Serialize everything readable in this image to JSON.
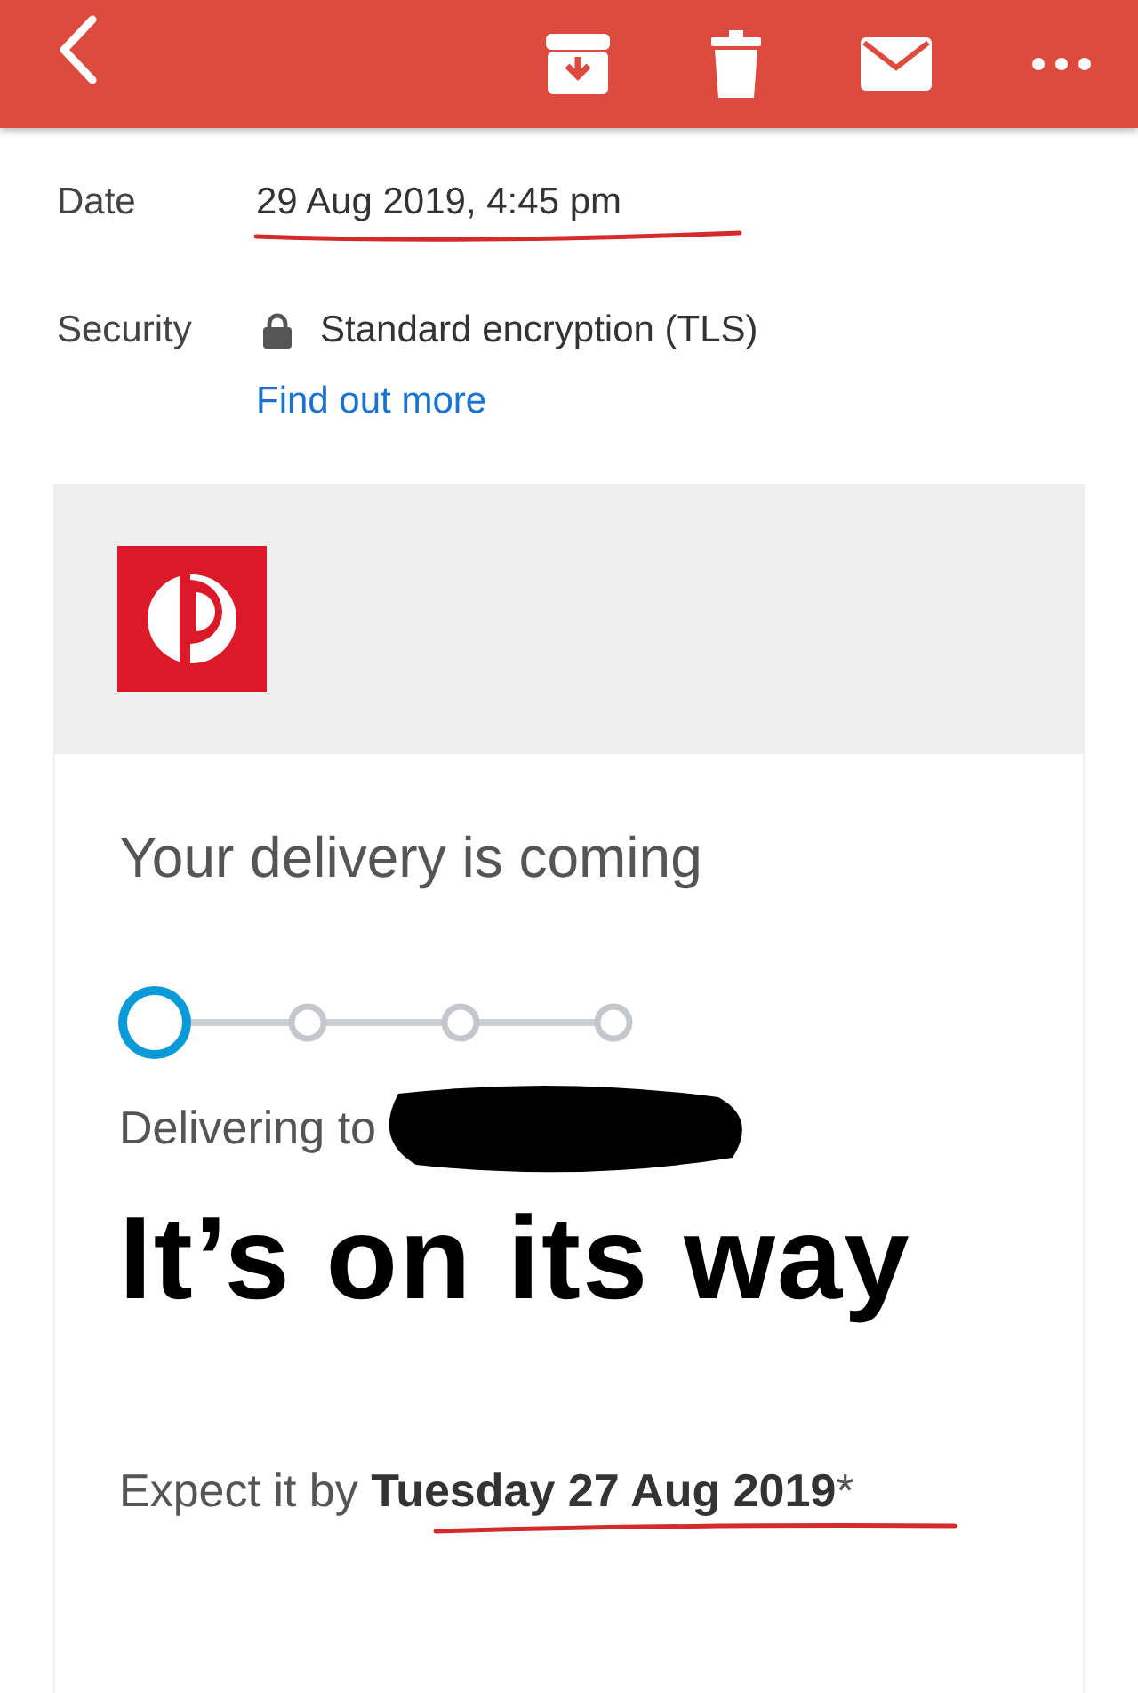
{
  "toolbar": {
    "icons": [
      {
        "kind": "back"
      },
      {
        "kind": "archive"
      },
      {
        "kind": "trash"
      },
      {
        "kind": "mail"
      },
      {
        "kind": "more"
      }
    ]
  },
  "details": [
    {
      "label": "Date",
      "value": "29 Aug 2019, 4:45 pm",
      "underlined": true
    },
    {
      "label": "Security",
      "value": "Standard encryption (TLS)",
      "locked": true,
      "link": "Find out more"
    }
  ],
  "email": {
    "title": "Your delivery is coming",
    "steps": [
      {
        "selected": true
      },
      {
        "selected": false
      },
      {
        "selected": false
      },
      {
        "selected": false
      }
    ],
    "delivering_label": "Delivering to",
    "redacted": true,
    "headline": "It’s on its way",
    "expect_text": "Expect it by **Tuesday 27 Aug 2019***",
    "expect_underlined": true
  }
}
